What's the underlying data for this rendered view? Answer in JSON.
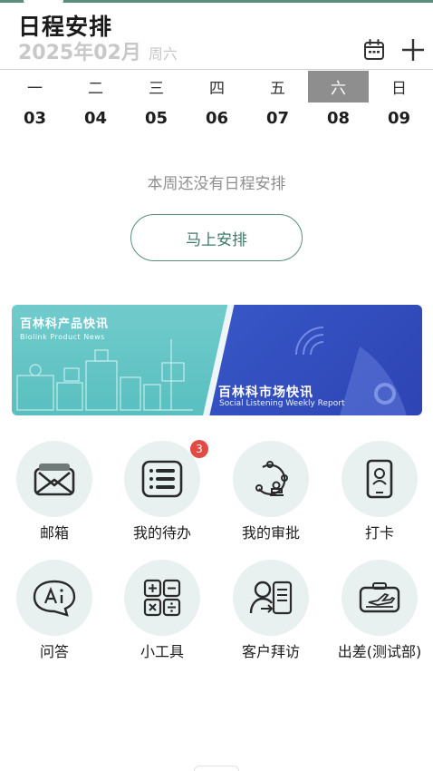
{
  "header": {
    "title": "日程安排",
    "date": "2025年02月",
    "weekday": "周六"
  },
  "week": [
    {
      "weekday": "一",
      "date": "03",
      "selected": false
    },
    {
      "weekday": "二",
      "date": "04",
      "selected": false
    },
    {
      "weekday": "三",
      "date": "05",
      "selected": false
    },
    {
      "weekday": "四",
      "date": "06",
      "selected": false
    },
    {
      "weekday": "五",
      "date": "07",
      "selected": false
    },
    {
      "weekday": "六",
      "date": "08",
      "selected": true
    },
    {
      "weekday": "日",
      "date": "09",
      "selected": false
    }
  ],
  "schedule": {
    "empty_text": "本周还没有日程安排",
    "arrange_button": "马上安排"
  },
  "banner": {
    "left_title": "百林科产品快讯",
    "left_subtitle": "Biolink Product News",
    "right_title": "百林科市场快讯",
    "right_subtitle": "Social Listening Weekly Report"
  },
  "apps": [
    {
      "label": "邮箱",
      "icon": "mailbox-icon"
    },
    {
      "label": "我的待办",
      "icon": "todo-list-icon",
      "badge": "3"
    },
    {
      "label": "我的审批",
      "icon": "approval-stamp-icon"
    },
    {
      "label": "打卡",
      "icon": "phone-checkin-icon"
    },
    {
      "label": "问答",
      "icon": "ai-chat-icon"
    },
    {
      "label": "小工具",
      "icon": "calculator-icon"
    },
    {
      "label": "客户拜访",
      "icon": "customer-visit-icon"
    },
    {
      "label": "出差(测试部)",
      "icon": "business-trip-ticket-icon"
    }
  ],
  "colors": {
    "accent": "#5a8d7d",
    "icon_bg": "#e8f1f0",
    "selected_day_bg": "#8e8e8e",
    "badge": "#e24b43"
  }
}
